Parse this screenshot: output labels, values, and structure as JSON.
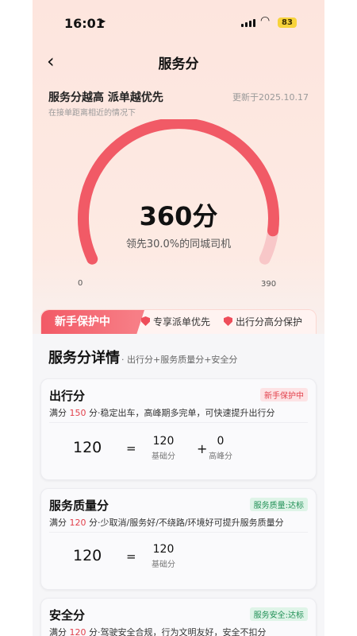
{
  "status_bar": {
    "time": "16:01",
    "battery": "83"
  },
  "nav": {
    "back_icon": "‹",
    "title": "服务分"
  },
  "header": {
    "headline": "服务分越高 派单越优先",
    "subline": "在接单距离相近的情况下",
    "updated": "更新于2025.10.17"
  },
  "gauge": {
    "score_text": "360分",
    "lead_text": "领先30.0%的同城司机",
    "min_label": "0",
    "max_label": "390",
    "score": 360,
    "max": 390,
    "colors": {
      "track": "#f8c7c8",
      "fill": "#f15a66"
    }
  },
  "protection": {
    "tag": "新手保护中",
    "perks": [
      "专享派单优先",
      "出行分高分保护"
    ]
  },
  "detail": {
    "title": "服务分详情",
    "subtitle": "· 出行分+服务质量分+安全分"
  },
  "cards": {
    "trip": {
      "name": "出行分",
      "badge": "新手保护中",
      "desc_prefix": "满分 ",
      "max": "150",
      "desc_suffix": " 分·稳定出车，高峰期多完单，可快速提升出行分",
      "total": "120",
      "equals": "=",
      "plus": "+",
      "base_value": "120",
      "base_label": "基础分",
      "peak_value": "0",
      "peak_label": "高峰分"
    },
    "quality": {
      "name": "服务质量分",
      "badge": "服务质量:达标",
      "desc_prefix": "满分 ",
      "max": "120",
      "desc_suffix": " 分·少取消/服务好/不绕路/环境好可提升服务质量分",
      "total": "120",
      "equals": "=",
      "base_value": "120",
      "base_label": "基础分"
    },
    "safety": {
      "name": "安全分",
      "badge": "服务安全:达标",
      "desc_prefix": "满分 ",
      "max": "120",
      "desc_suffix": " 分·驾驶安全合规，行为文明友好，安全不扣分"
    }
  }
}
